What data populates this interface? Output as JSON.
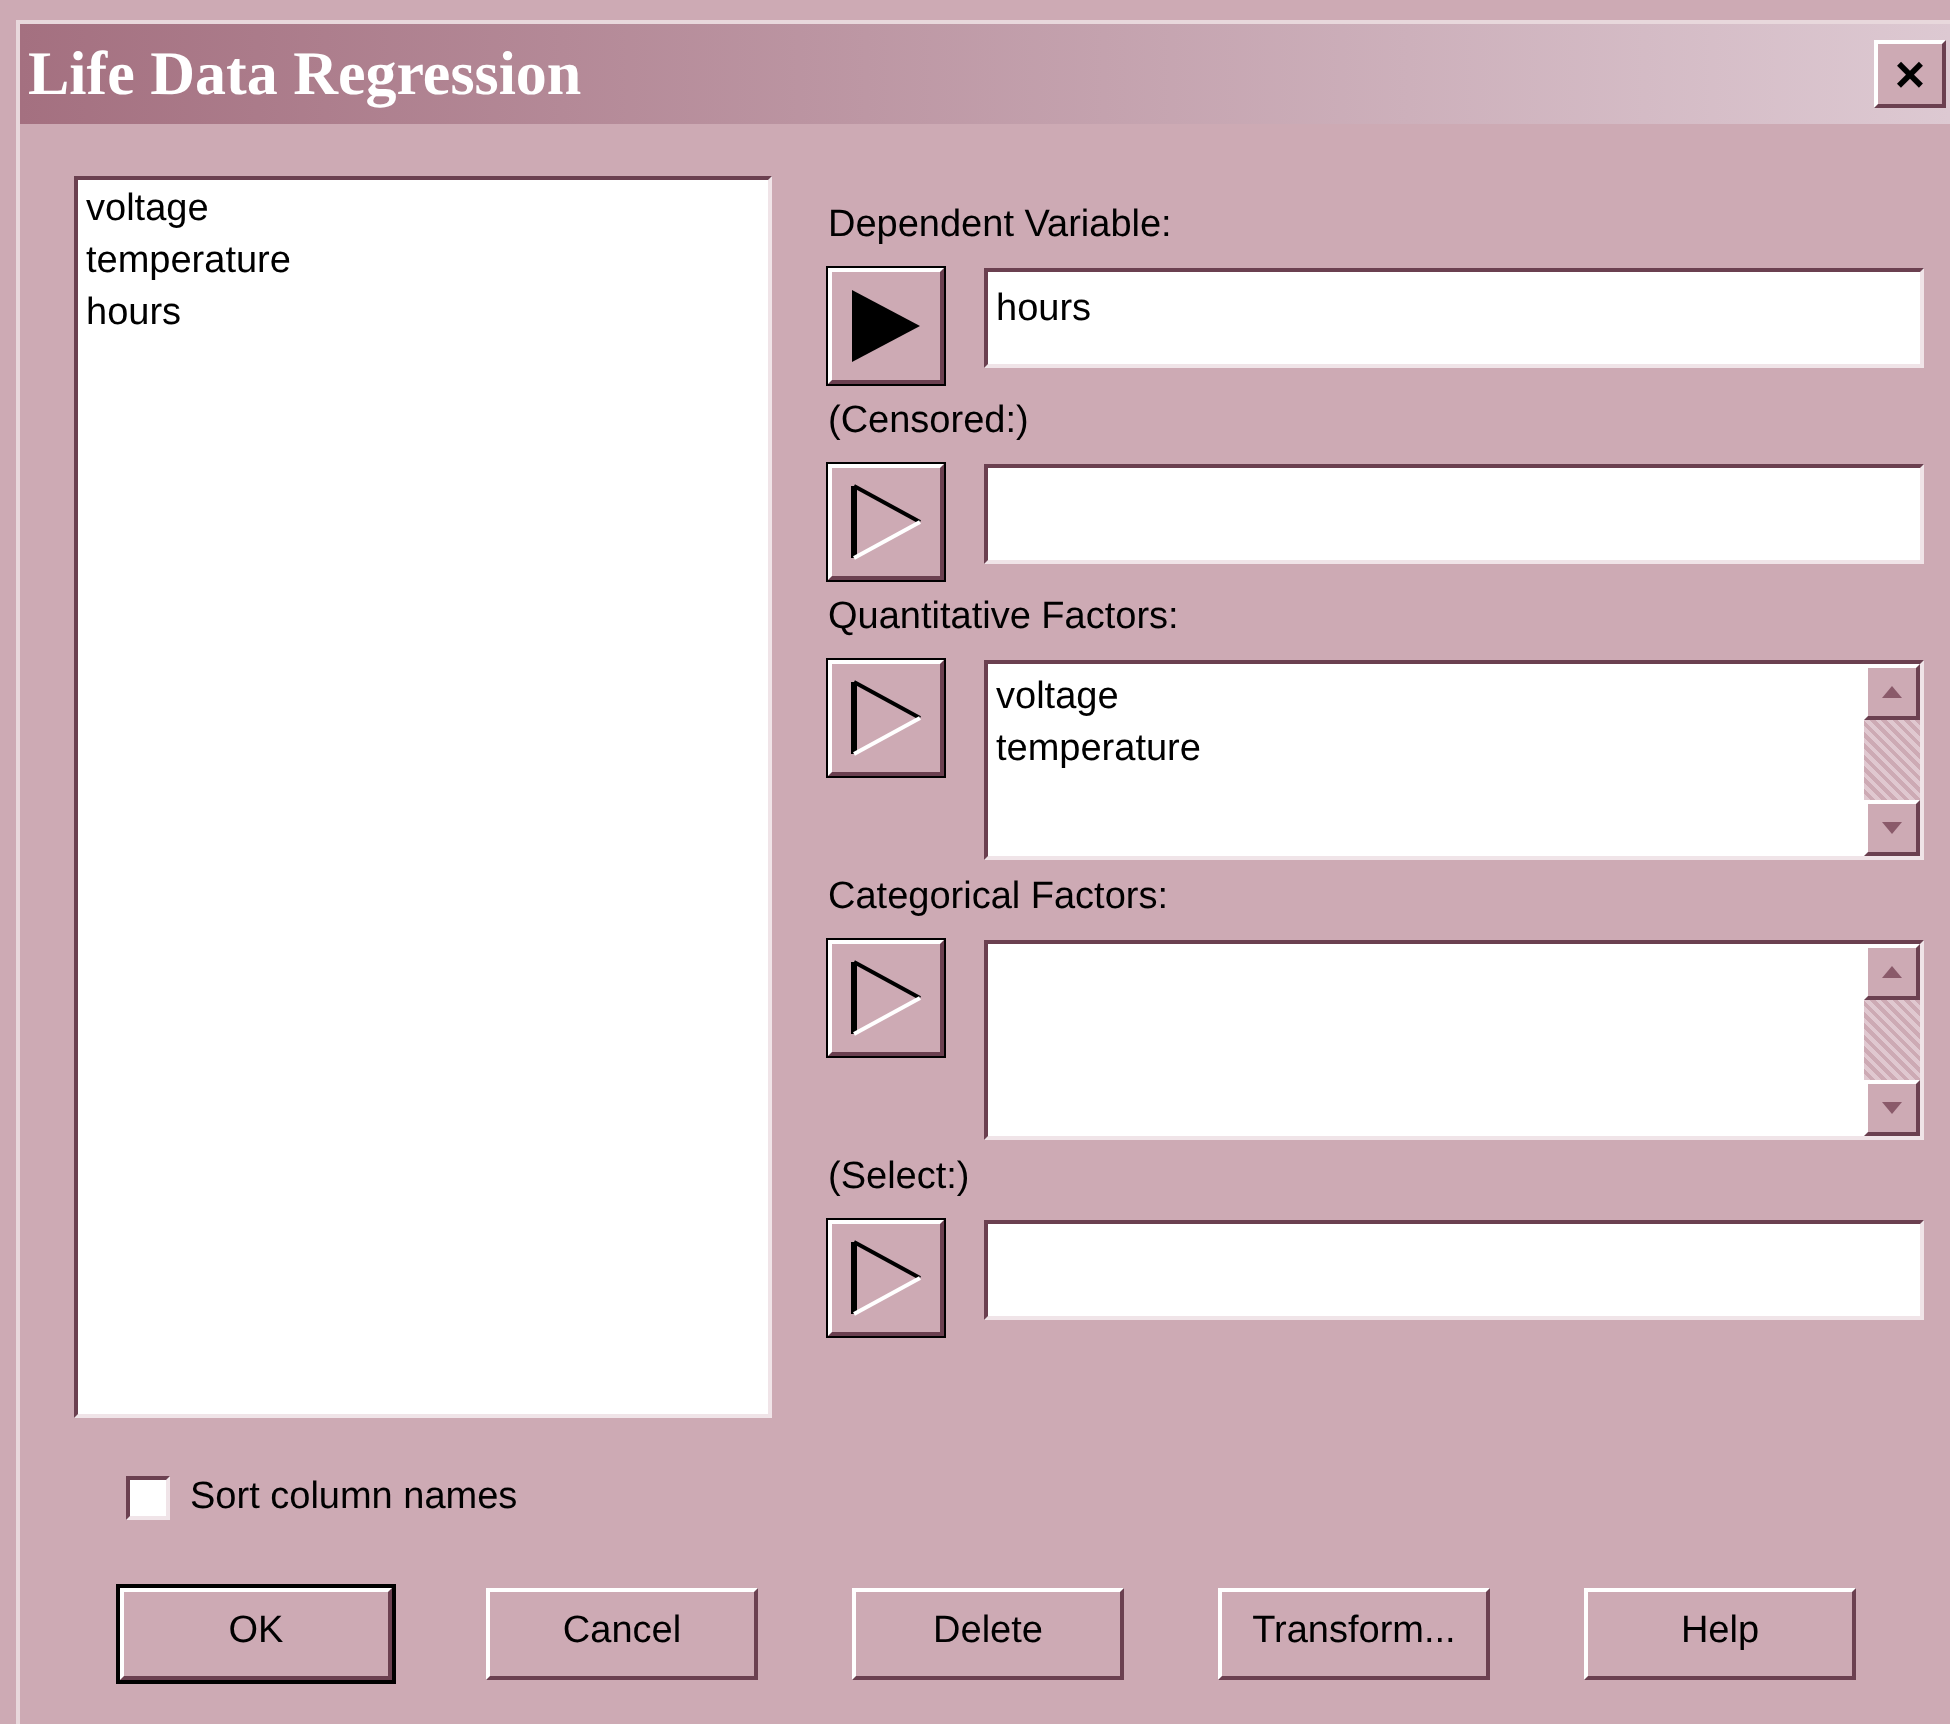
{
  "window": {
    "title": "Life Data Regression",
    "close": "×"
  },
  "columns_list": {
    "items": [
      "voltage",
      "temperature",
      "hours"
    ]
  },
  "inputs": [
    {
      "label": "Dependent Variable:",
      "kind": "field",
      "active": true,
      "value": "hours"
    },
    {
      "label": "(Censored:)",
      "kind": "field",
      "active": false
    },
    {
      "label": "Quantitative Factors:",
      "kind": "list",
      "active": false,
      "items": [
        "voltage",
        "temperature"
      ]
    },
    {
      "label": "Categorical Factors:",
      "kind": "list",
      "active": false
    },
    {
      "label": "(Select:)",
      "kind": "field",
      "active": false
    }
  ],
  "sort_checkbox": {
    "label": "Sort column names",
    "checked": false
  },
  "buttons": [
    {
      "label": "OK",
      "default": true
    },
    {
      "label": "Cancel",
      "default": false
    },
    {
      "label": "Delete",
      "default": false
    },
    {
      "label": "Transform...",
      "default": false
    },
    {
      "label": "Help",
      "default": false
    }
  ]
}
